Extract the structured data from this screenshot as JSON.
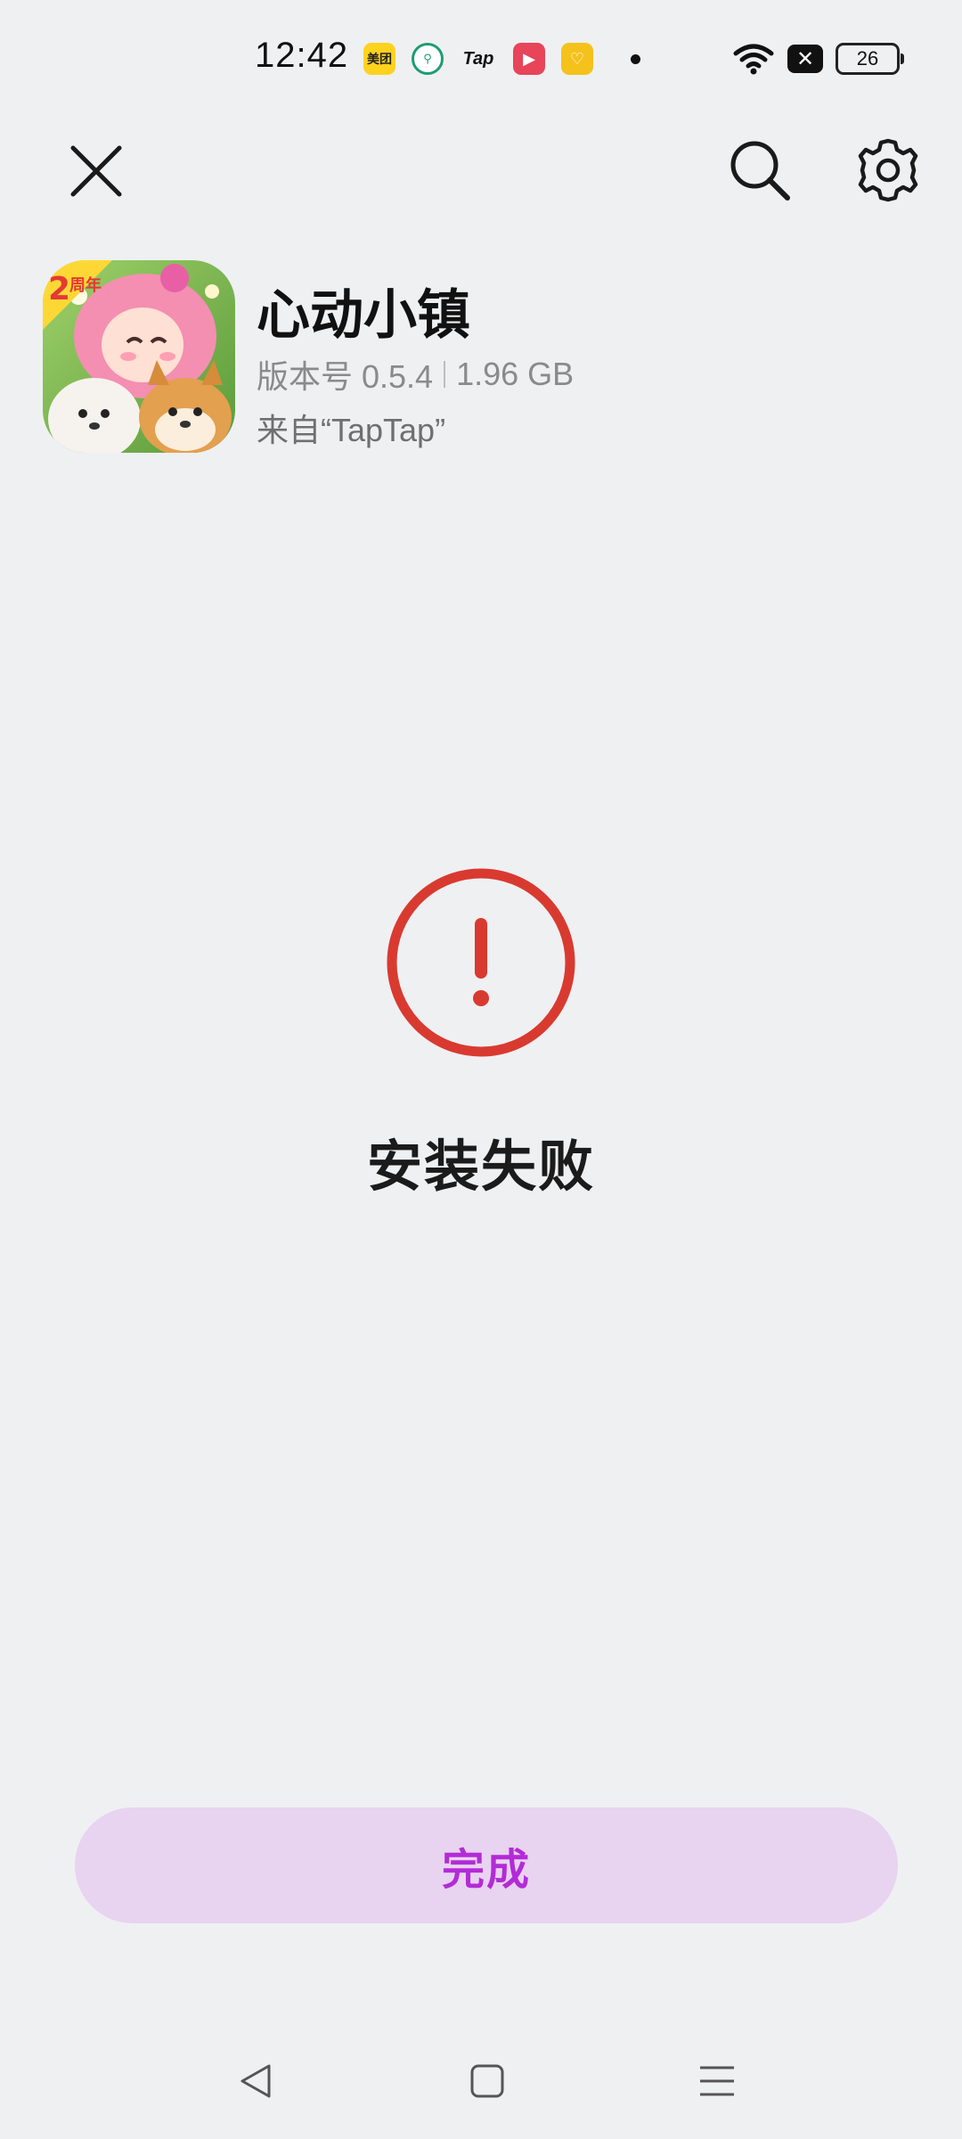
{
  "status_bar": {
    "time": "12:42",
    "battery": "26",
    "notification_apps": [
      "meituan-icon",
      "bank-icon",
      "taptap-icon",
      "video-icon",
      "heart-app-icon"
    ],
    "meituan_text": "美团",
    "tap_text": "Tap"
  },
  "app": {
    "name": "心动小镇",
    "version": "版本号 0.5.4",
    "size": "1.96 GB",
    "source": "来自“TapTap”",
    "icon_badge": "2周年"
  },
  "result": {
    "title": "安装失败",
    "status_color": "#d93a30"
  },
  "actions": {
    "done_label": "完成",
    "accent_color": "#b32bd7",
    "button_bg": "#e8d3f0"
  }
}
